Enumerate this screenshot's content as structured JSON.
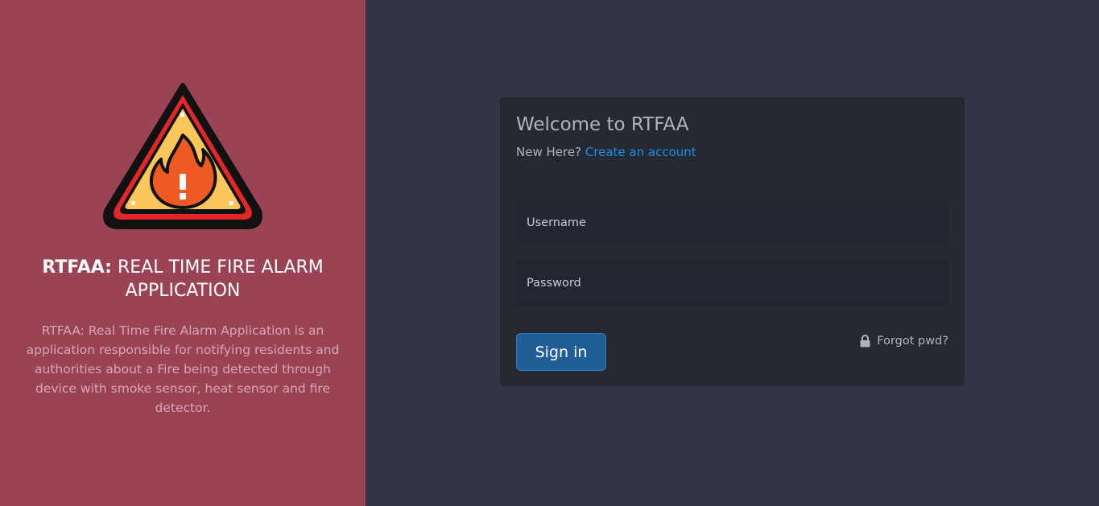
{
  "brand": {
    "title_bold": "RTFAA:",
    "title_rest": "REAL TIME FIRE ALARM APPLICATION",
    "description": "RTFAA: Real Time Fire Alarm Application is an application responsible for notifying residents and authorities about a Fire being detected through device with smoke sensor, heat sensor and fire detector.",
    "logo_icon": "fire-warning-icon"
  },
  "login": {
    "heading": "Welcome to RTFAA",
    "new_here": "New Here?",
    "create_account": "Create an account",
    "username_placeholder": "Username",
    "password_placeholder": "Password",
    "signin_label": "Sign in",
    "forgot_label": "Forgot pwd?",
    "forgot_icon": "lock-icon"
  },
  "colors": {
    "left_bg": "#9a4355",
    "right_bg": "#323644",
    "card_bg": "#252932",
    "link": "#1c8fea",
    "button": "#215e97"
  }
}
